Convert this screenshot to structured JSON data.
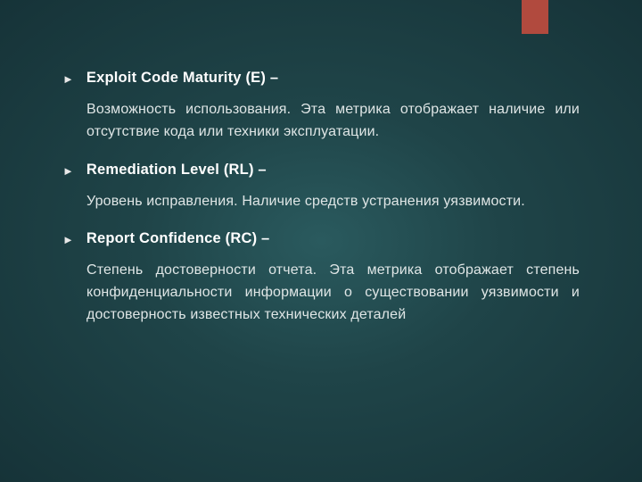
{
  "items": [
    {
      "title": "Exploit Code Maturity (E) –",
      "description": "Возможность использования. Эта метрика отображает наличие или отсутствие кода или техники эксплуатации."
    },
    {
      "title": "Remediation Level (RL) –",
      "description": "Уровень исправления. Наличие средств устранения уязвимости."
    },
    {
      "title": "Report Confidence (RC) –",
      "description": "Степень достоверности отчета. Эта метрика отображает степень конфиденциальности информации о существовании уязвимости и достоверность известных технических деталей"
    }
  ]
}
